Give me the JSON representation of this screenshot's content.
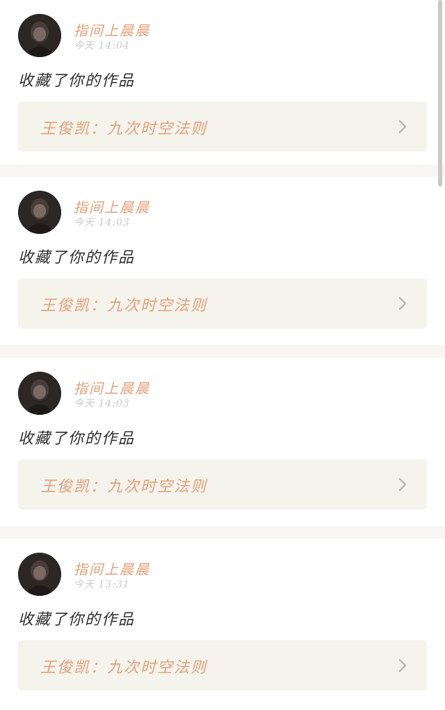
{
  "feed": {
    "items": [
      {
        "username": "指间上晨晨",
        "timestamp": "今天 14:04",
        "action": "收藏了你的作品",
        "work_title": "王俊凯：九次时空法则"
      },
      {
        "username": "指间上晨晨",
        "timestamp": "今天 14:03",
        "action": "收藏了你的作品",
        "work_title": "王俊凯：九次时空法则"
      },
      {
        "username": "指间上晨晨",
        "timestamp": "今天 14:03",
        "action": "收藏了你的作品",
        "work_title": "王俊凯：九次时空法则"
      },
      {
        "username": "指间上晨晨",
        "timestamp": "今天 13:31",
        "action": "收藏了你的作品",
        "work_title": "王俊凯：九次时空法则"
      }
    ]
  },
  "colors": {
    "accent": "#e3a077",
    "link_bg": "#f4f3ec",
    "page_bg": "#f7f6f4"
  },
  "icons": {
    "avatar": "user-avatar",
    "chevron": "chevron-right-icon"
  }
}
